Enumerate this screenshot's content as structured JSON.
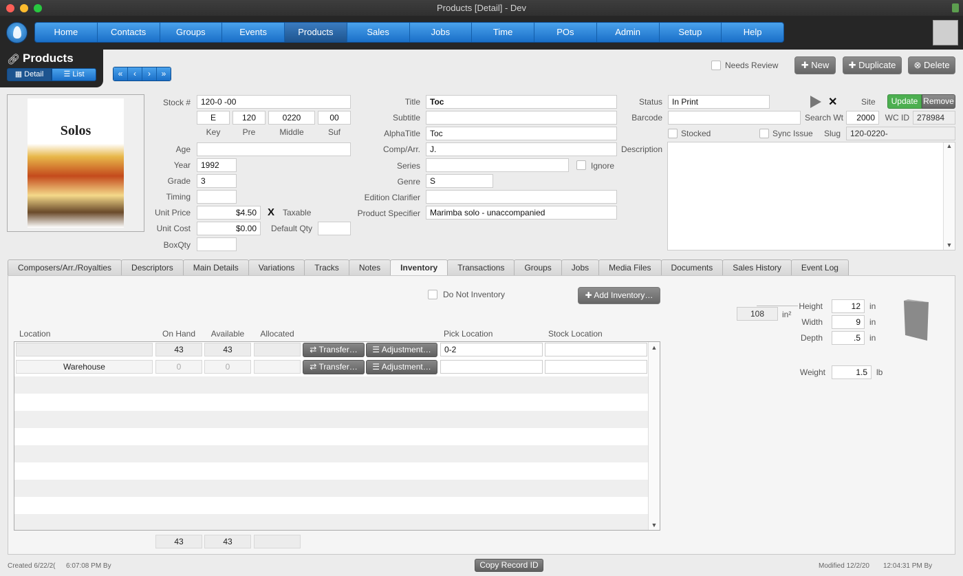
{
  "window": {
    "title": "Products [Detail] - Dev"
  },
  "nav": {
    "items": [
      "Home",
      "Contacts",
      "Groups",
      "Events",
      "Products",
      "Sales",
      "Jobs",
      "Time",
      "POs",
      "Admin",
      "Setup",
      "Help"
    ],
    "active": "Products"
  },
  "page": {
    "title": "Products",
    "view_detail": "Detail",
    "view_list": "List"
  },
  "toolbar": {
    "needs_review": "Needs Review",
    "new": "New",
    "duplicate": "Duplicate",
    "delete": "Delete"
  },
  "cover": {
    "text": "Solos"
  },
  "fields": {
    "stock_label": "Stock #",
    "stock_value": "120-0      -00",
    "key_value": "E",
    "pre_value": "120",
    "middle_value": "0220",
    "suf_value": "00",
    "key_label": "Key",
    "pre_label": "Pre",
    "middle_label": "Middle",
    "suf_label": "Suf",
    "age_label": "Age",
    "age_value": "",
    "year_label": "Year",
    "year_value": "1992",
    "grade_label": "Grade",
    "grade_value": "3",
    "timing_label": "Timing",
    "timing_value": "",
    "unit_price_label": "Unit Price",
    "unit_price_value": "$4.50",
    "taxable_label": "Taxable",
    "taxable_mark": "X",
    "unit_cost_label": "Unit Cost",
    "unit_cost_value": "$0.00",
    "default_qty_label": "Default Qty",
    "default_qty_value": "",
    "boxqty_label": "BoxQty",
    "boxqty_value": "",
    "title_label": "Title",
    "title_value": "Toc",
    "subtitle_label": "Subtitle",
    "subtitle_value": "",
    "alphatitle_label": "AlphaTitle",
    "alphatitle_value": "Toc",
    "comp_label": "Comp/Arr.",
    "comp_value": "J.",
    "series_label": "Series",
    "series_value": "",
    "ignore_label": "Ignore",
    "genre_label": "Genre",
    "genre_value": "S",
    "edition_label": "Edition Clarifier",
    "edition_value": "",
    "specifier_label": "Product Specifier",
    "specifier_value": "Marimba solo - unaccompanied",
    "status_label": "Status",
    "status_value": "In Print",
    "site_label": "Site",
    "update": "Update",
    "remove": "Remove",
    "barcode_label": "Barcode",
    "barcode_value": "",
    "search_wt_label": "Search Wt",
    "search_wt_value": "2000",
    "wcid_label": "WC ID",
    "wcid_value": "278984",
    "stocked_label": "Stocked",
    "sync_label": "Sync Issue",
    "slug_label": "Slug",
    "slug_value": "120-0220-",
    "description_label": "Description",
    "description_value": ""
  },
  "tabs": [
    "Composers/Arr./Royalties",
    "Descriptors",
    "Main Details",
    "Variations",
    "Tracks",
    "Notes",
    "Inventory",
    "Transactions",
    "Groups",
    "Jobs",
    "Media Files",
    "Documents",
    "Sales History",
    "Event Log"
  ],
  "active_tab": "Inventory",
  "inventory": {
    "do_not_inventory": "Do Not Inventory",
    "add_inventory": "Add Inventory…",
    "headers": {
      "location": "Location",
      "on_hand": "On Hand",
      "available": "Available",
      "allocated": "Allocated",
      "pick": "Pick Location",
      "stock": "Stock Location"
    },
    "transfer": "Transfer…",
    "adjustment": "Adjustment…",
    "rows": [
      {
        "location": "",
        "on_hand": "43",
        "available": "43",
        "allocated": "",
        "pick": "0-2",
        "stock": ""
      },
      {
        "location": "Warehouse",
        "on_hand": "0",
        "available": "0",
        "allocated": "",
        "pick": "",
        "stock": ""
      }
    ],
    "totals": {
      "on_hand": "43",
      "available": "43",
      "allocated": ""
    }
  },
  "dimensions": {
    "area_value": "108",
    "area_unit": "in²",
    "height_label": "Height",
    "height_value": "12",
    "height_unit": "in",
    "width_label": "Width",
    "width_value": "9",
    "width_unit": "in",
    "depth_label": "Depth",
    "depth_value": ".5",
    "depth_unit": "in",
    "weight_label": "Weight",
    "weight_value": "1.5",
    "weight_unit": "lb"
  },
  "footer": {
    "created_label": "Created 6/22/2(",
    "created_time": "6:07:08 PM By",
    "copy_record": "Copy Record ID",
    "modified_label": "Modified 12/2/20",
    "modified_time": "12:04:31 PM By"
  }
}
